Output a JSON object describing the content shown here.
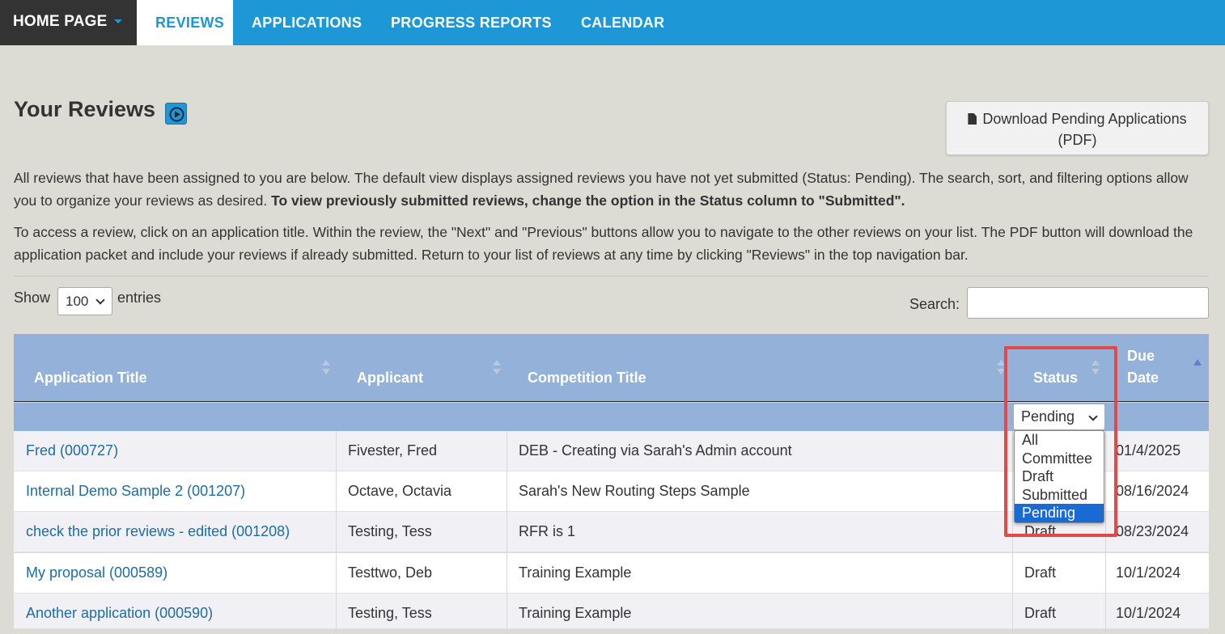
{
  "nav": {
    "home": "HOME PAGE",
    "tabs": [
      "REVIEWS",
      "APPLICATIONS",
      "PROGRESS REPORTS",
      "CALENDAR"
    ],
    "active_tab": "REVIEWS",
    "bar_color": "#1e97d6"
  },
  "page": {
    "title": "Your Reviews",
    "download_button_line1": "Download Pending Applications",
    "download_button_line2": "(PDF)",
    "intro_1a": "All reviews that have been assigned to you are below. The default view displays assigned reviews you have not yet submitted (Status: Pending). The search, sort, and filtering options allow you to organize your reviews as desired.",
    "intro_1b": "To view previously submitted reviews, change the option in the Status column to \"Submitted\".",
    "intro_2": "To access a review, click on an application title. Within the review, the \"Next\" and \"Previous\" buttons allow you to navigate to the other reviews on your list. The PDF button will download the application packet and include your reviews if already submitted. Return to your list of reviews at any time by clicking \"Reviews\" in the top navigation bar."
  },
  "controls": {
    "show_label": "Show",
    "entries_value": "100",
    "entries_label": "entries",
    "search_label": "Search:",
    "search_value": ""
  },
  "table": {
    "columns": [
      "Application Title",
      "Applicant",
      "Competition Title",
      "Status",
      "Due",
      "Date"
    ],
    "status_filter_value": "Pending",
    "status_options": [
      "All",
      "Committee",
      "Draft",
      "Submitted",
      "Pending"
    ],
    "status_selected": "Pending",
    "rows": [
      {
        "title": "Fred (000727)",
        "applicant": "Fivester, Fred",
        "competition": "DEB - Creating via Sarah's Admin account",
        "status": "",
        "due": "01/4/2025"
      },
      {
        "title": "Internal Demo Sample 2 (001207)",
        "applicant": "Octave, Octavia",
        "competition": "Sarah's New Routing Steps Sample",
        "status": "",
        "due": "08/16/2024"
      },
      {
        "title": "check the prior reviews - edited (001208)",
        "applicant": "Testing, Tess",
        "competition": "RFR is 1",
        "status": "Draft",
        "due": "08/23/2024"
      },
      {
        "title": "My proposal (000589)",
        "applicant": "Testtwo, Deb",
        "competition": "Training Example",
        "status": "Draft",
        "due": "10/1/2024"
      },
      {
        "title": "Another application (000590)",
        "applicant": "Testing, Tess",
        "competition": "Training Example",
        "status": "Draft",
        "due": "10/1/2024"
      }
    ],
    "highlight_color": "#e04a4a"
  }
}
